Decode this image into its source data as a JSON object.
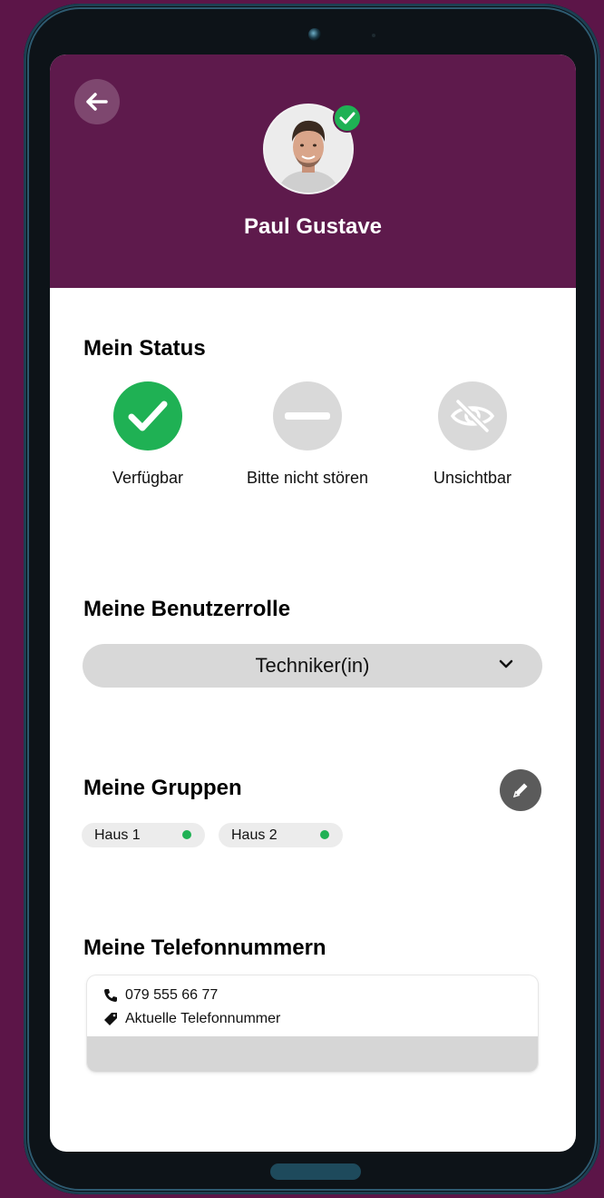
{
  "header": {
    "user_name": "Paul Gustave",
    "back_icon": "arrow-left-icon",
    "verified_icon": "check-circle-icon",
    "background_color": "#5e1a4c"
  },
  "status": {
    "title": "Mein Status",
    "options": [
      {
        "label": "Verfügbar",
        "icon": "check-icon",
        "selected": true,
        "color": "#1fb154"
      },
      {
        "label": "Bitte nicht stören",
        "icon": "minus-icon",
        "selected": false,
        "color": "#d9d9d9"
      },
      {
        "label": "Unsichtbar",
        "icon": "eye-slash-icon",
        "selected": false,
        "color": "#d9d9d9"
      }
    ]
  },
  "role": {
    "title": "Meine Benutzerrolle",
    "selected": "Techniker(in)",
    "icon": "chevron-down-icon"
  },
  "groups": {
    "title": "Meine Gruppen",
    "edit_icon": "pencil-icon",
    "items": [
      {
        "label": "Haus 1",
        "online": true
      },
      {
        "label": "Haus 2",
        "online": true
      }
    ],
    "online_color": "#1fb154"
  },
  "phones": {
    "title": "Meine Telefonnummern",
    "number": "079 555 66 77",
    "tag": "Aktuelle Telefonnummer",
    "number_icon": "phone-icon",
    "tag_icon": "tag-icon"
  }
}
